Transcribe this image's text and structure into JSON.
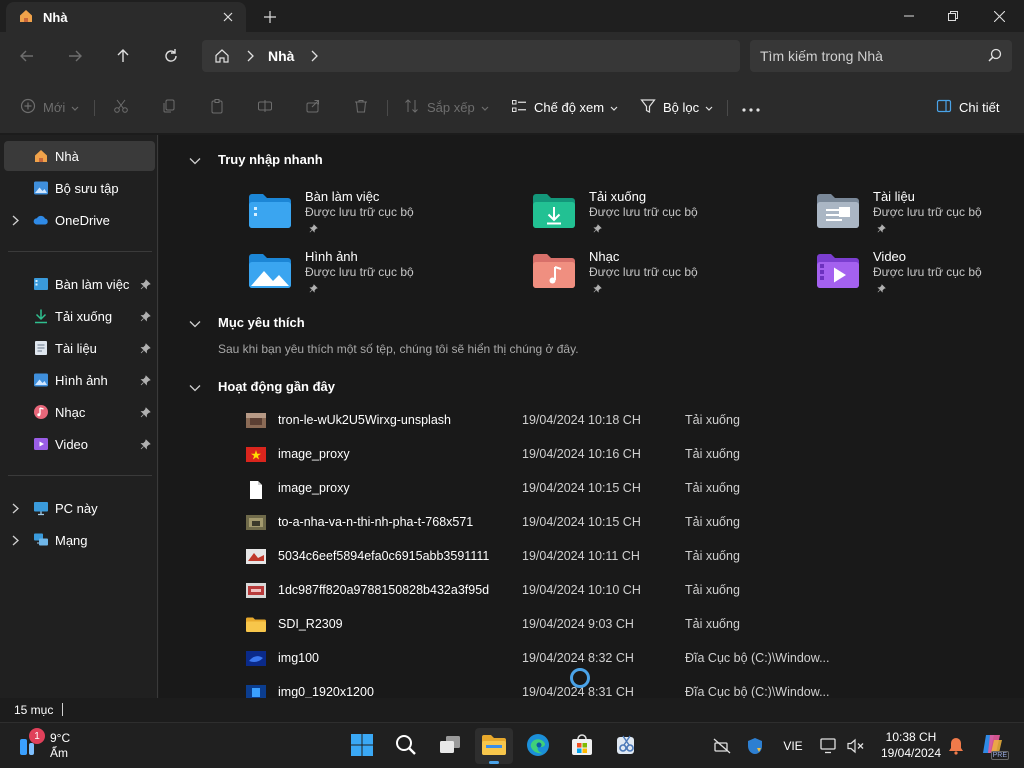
{
  "window": {
    "tab_title": "Nhà",
    "colors": {
      "accent": "#4aa3e8",
      "background": "#191919",
      "toolbar": "#2b2b2b"
    }
  },
  "address": {
    "breadcrumb": "Nhà",
    "search_placeholder": "Tìm kiếm trong Nhà"
  },
  "commands": {
    "new": "Mới",
    "sort": "Sắp xếp",
    "view": "Chế độ xem",
    "filter": "Bộ lọc",
    "details": "Chi tiết"
  },
  "sidebar": {
    "items": [
      {
        "label": "Nhà",
        "icon": "home-icon"
      },
      {
        "label": "Bộ sưu tập",
        "icon": "gallery-icon"
      },
      {
        "label": "OneDrive",
        "icon": "onedrive-icon"
      },
      {
        "label": "Bàn làm việc",
        "icon": "desktop-icon"
      },
      {
        "label": "Tải xuống",
        "icon": "download-icon"
      },
      {
        "label": "Tài liệu",
        "icon": "documents-icon"
      },
      {
        "label": "Hình ảnh",
        "icon": "pictures-icon"
      },
      {
        "label": "Nhạc",
        "icon": "music-icon"
      },
      {
        "label": "Video",
        "icon": "video-icon"
      },
      {
        "label": "PC này",
        "icon": "pc-icon"
      },
      {
        "label": "Mạng",
        "icon": "network-icon"
      }
    ]
  },
  "sections": {
    "quick_access": "Truy nhập nhanh",
    "favorites": "Mục yêu thích",
    "favorites_note": "Sau khi bạn yêu thích một số tệp, chúng tôi sẽ hiển thị chúng ở đây.",
    "recent": "Hoạt động gần đây"
  },
  "quick_access": [
    {
      "name": "Bàn làm việc",
      "sub": "Được lưu trữ cục bộ",
      "icon": "desktop-folder-icon"
    },
    {
      "name": "Tải xuống",
      "sub": "Được lưu trữ cục bộ",
      "icon": "downloads-folder-icon"
    },
    {
      "name": "Tài liệu",
      "sub": "Được lưu trữ cục bộ",
      "icon": "documents-folder-icon"
    },
    {
      "name": "Hình ảnh",
      "sub": "Được lưu trữ cục bộ",
      "icon": "pictures-folder-icon"
    },
    {
      "name": "Nhạc",
      "sub": "Được lưu trữ cục bộ",
      "icon": "music-folder-icon"
    },
    {
      "name": "Video",
      "sub": "Được lưu trữ cục bộ",
      "icon": "video-folder-icon"
    }
  ],
  "recent": [
    {
      "name": "tron-le-wUk2U5Wirxg-unsplash",
      "date": "19/04/2024 10:18 CH",
      "location": "Tải xuống"
    },
    {
      "name": "image_proxy",
      "date": "19/04/2024 10:16 CH",
      "location": "Tải xuống"
    },
    {
      "name": "image_proxy",
      "date": "19/04/2024 10:15 CH",
      "location": "Tải xuống"
    },
    {
      "name": "to-a-nha-va-n-thi-nh-pha-t-768x571",
      "date": "19/04/2024 10:15 CH",
      "location": "Tải xuống"
    },
    {
      "name": "5034c6eef5894efa0c6915abb3591111",
      "date": "19/04/2024 10:11 CH",
      "location": "Tải xuống"
    },
    {
      "name": "1dc987ff820a9788150828b432a3f95d",
      "date": "19/04/2024 10:10 CH",
      "location": "Tải xuống"
    },
    {
      "name": "SDI_R2309",
      "date": "19/04/2024 9:03 CH",
      "location": "Tải xuống"
    },
    {
      "name": "img100",
      "date": "19/04/2024 8:32 CH",
      "location": "Đĩa Cục bộ (C:)\\Window..."
    },
    {
      "name": "img0_1920x1200",
      "date": "19/04/2024 8:31 CH",
      "location": "Đĩa Cục bộ (C:)\\Window..."
    }
  ],
  "status": {
    "count": "15 mục"
  },
  "taskbar": {
    "weather_temp": "9°C",
    "weather_cond": "Ẩm",
    "weather_badge": "1",
    "language": "VIE",
    "time": "10:38 CH",
    "date": "19/04/2024",
    "copilot_badge": "PRE"
  }
}
